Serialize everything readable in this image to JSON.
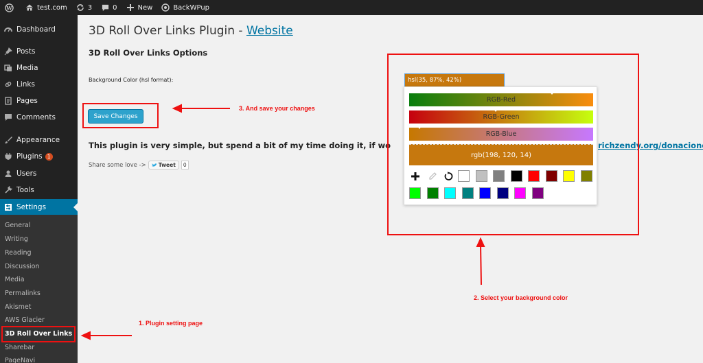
{
  "adminbar": {
    "site": "test.com",
    "updates_count": "3",
    "comments_count": "0",
    "new_label": "New",
    "backwpup_label": "BackWPup"
  },
  "sidebar": {
    "items": [
      {
        "label": "Dashboard",
        "icon": "dashboard-icon"
      },
      {
        "label": "Posts",
        "icon": "pin-icon"
      },
      {
        "label": "Media",
        "icon": "media-icon"
      },
      {
        "label": "Links",
        "icon": "link-icon"
      },
      {
        "label": "Pages",
        "icon": "page-icon"
      },
      {
        "label": "Comments",
        "icon": "comment-icon"
      },
      {
        "label": "Appearance",
        "icon": "brush-icon"
      },
      {
        "label": "Plugins",
        "icon": "plug-icon",
        "badge": "1"
      },
      {
        "label": "Users",
        "icon": "users-icon"
      },
      {
        "label": "Tools",
        "icon": "wrench-icon"
      },
      {
        "label": "Settings",
        "icon": "settings-icon",
        "active": true
      }
    ],
    "submenu": [
      "General",
      "Writing",
      "Reading",
      "Discussion",
      "Media",
      "Permalinks",
      "Akismet",
      "AWS Glacier",
      "3D Roll Over Links",
      "Sharebar",
      "PageNavi"
    ]
  },
  "main": {
    "title": "3D Roll Over Links Plugin - ",
    "title_link": "Website",
    "options_title": "3D Roll Over Links Options",
    "field_label": "Background Color (hsl format):",
    "field_value": "hsl(35, 87%, 42%)",
    "save_label": "Save Changes",
    "description": "This plugin is very simple, but spend a bit of my time doing it, if works for you pl",
    "description_link": "richzendy.org/donaciones",
    "share_label": "Share some love ->",
    "tweet_label": "Tweet",
    "tweet_count": "0"
  },
  "picker": {
    "sliders": [
      {
        "label": "RGB-Red",
        "gradient": [
          "#097e0e",
          "#f98d0e"
        ],
        "value": 198
      },
      {
        "label": "RGB-Green",
        "gradient": [
          "#c6000e",
          "#c6ff0e"
        ],
        "value": 120
      },
      {
        "label": "RGB-Blue",
        "gradient": [
          "#c67800",
          "#c678ff"
        ],
        "value": 14
      }
    ],
    "preview_label": "rgb(198, 120, 14)",
    "preview_color": "#c6780e",
    "tools": [
      "plus-icon",
      "dropper-icon",
      "reset-icon"
    ],
    "swatches": [
      "#ffffff",
      "#c0c0c0",
      "#808080",
      "#000000",
      "#ff0000",
      "#800000",
      "#ffff00",
      "#808000",
      "#00ff00",
      "#008000",
      "#00ffff",
      "#008080",
      "#0000ff",
      "#000080",
      "#ff00ff",
      "#800080"
    ]
  },
  "annotations": {
    "step1": "1. Plugin setting page",
    "step2": "2. Select your background color",
    "step3": "3. And save your changes",
    "color": "#ee1111"
  },
  "colors": {
    "accent": "#0074a2",
    "button": "#2ea2cc",
    "admin_dark": "#222222"
  }
}
